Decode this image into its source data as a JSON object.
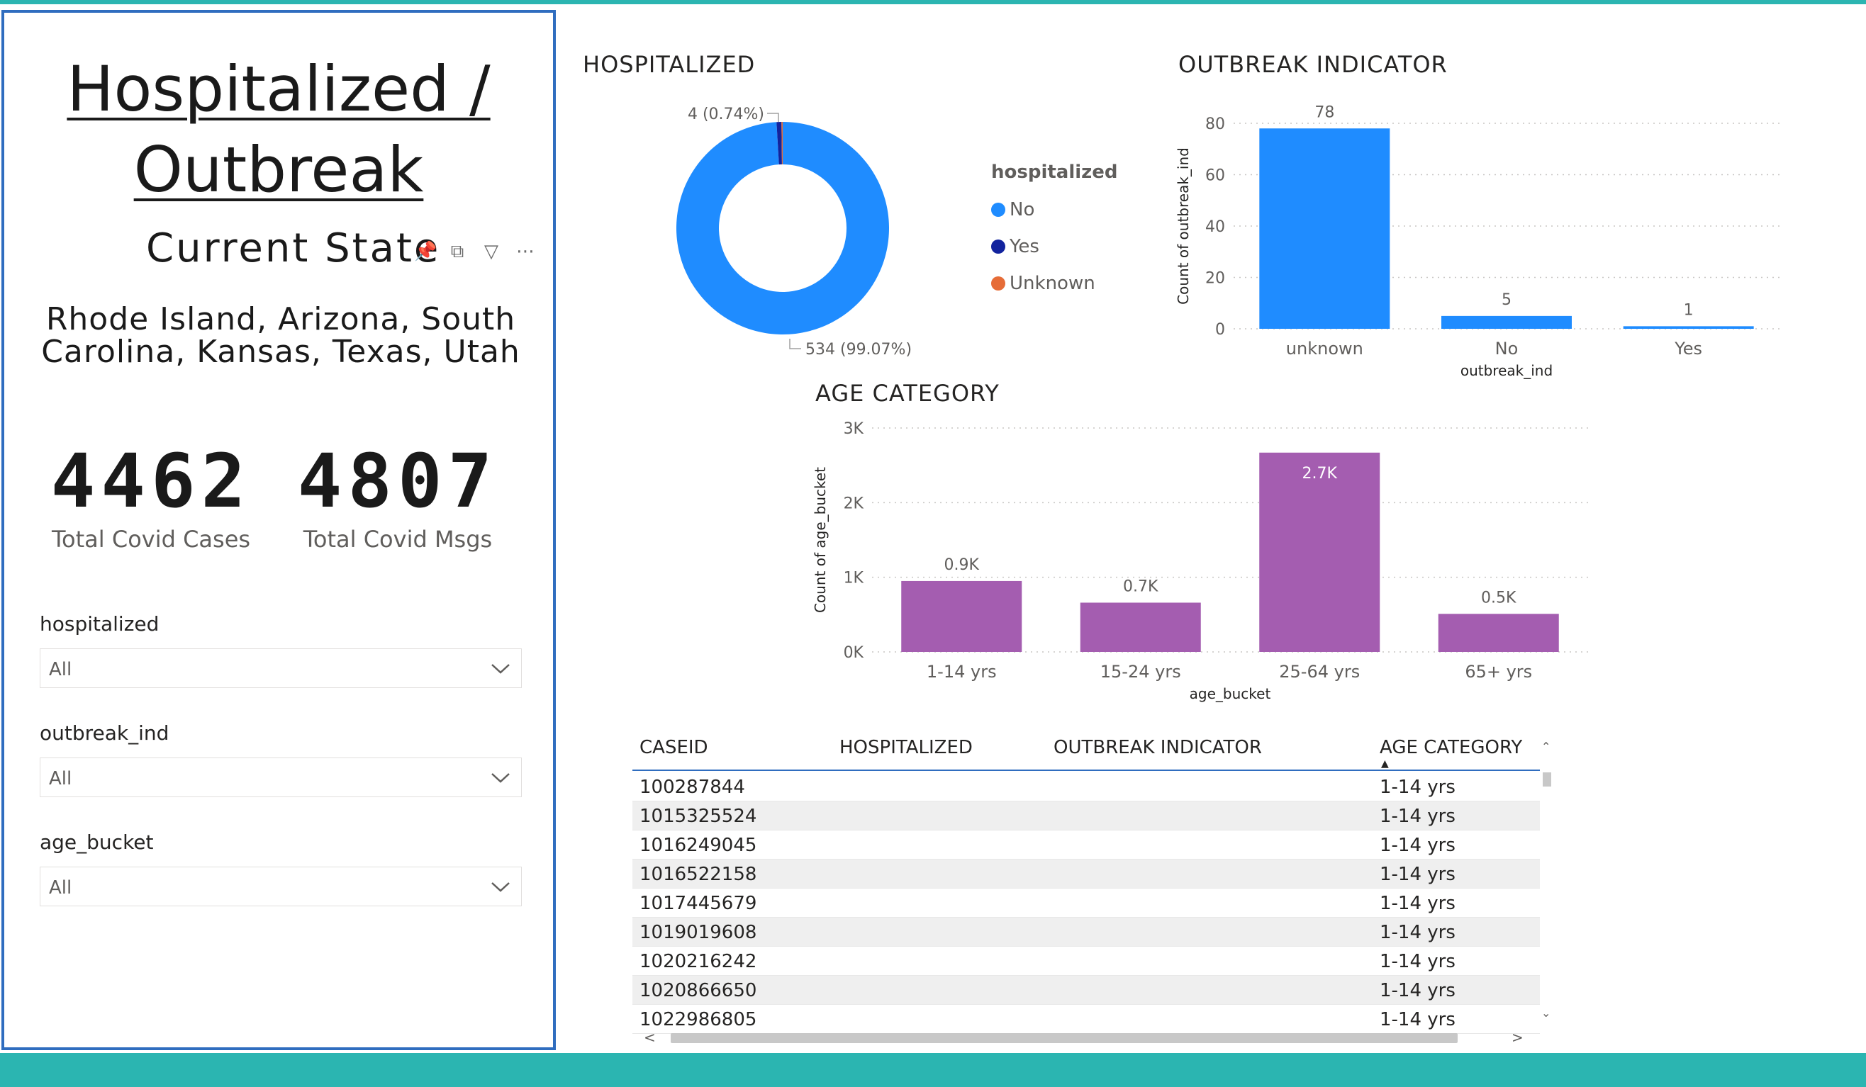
{
  "left_panel": {
    "title_line1": "Hospitalized / ",
    "title_line2": "Outbreak",
    "current_state_label": "Current State",
    "icons": [
      "pin-icon",
      "copy-icon",
      "filter-icon",
      "more-options-icon"
    ],
    "states_line1": "Rhode Island, Arizona, South",
    "states_line2": "Carolina, Kansas, Texas, Utah",
    "kpis": [
      {
        "value": "4462",
        "label": "Total Covid Cases"
      },
      {
        "value": "4807",
        "label": "Total Covid Msgs"
      }
    ],
    "slicers": [
      {
        "title": "hospitalized",
        "value": "All"
      },
      {
        "title": "outbreak_ind",
        "value": "All"
      },
      {
        "title": "age_bucket",
        "value": "All"
      }
    ]
  },
  "colors": {
    "accent_blue": "#2f6dbf",
    "no": "#1f8cff",
    "yes": "#12239e",
    "unknown": "#e66c37",
    "age_bar": "#a45db0",
    "background_band": "#2bb5b1"
  },
  "chart_data": [
    {
      "type": "pie",
      "title": "HOSPITALIZED",
      "legend_title": "hospitalized",
      "legend_position": "right",
      "slices": [
        {
          "label": "No",
          "value": 534,
          "data_label": "534 (99.07%)"
        },
        {
          "label": "Yes",
          "value": 4,
          "data_label": "4 (0.74%)"
        },
        {
          "label": "Unknown",
          "value": 1,
          "data_label": ""
        }
      ]
    },
    {
      "type": "bar",
      "title": "OUTBREAK INDICATOR",
      "categories": [
        "unknown",
        "No",
        "Yes"
      ],
      "values": [
        78,
        5,
        1
      ],
      "data_labels": [
        "78",
        "5",
        "1"
      ],
      "xlabel": "outbreak_ind",
      "ylabel": "Count of outbreak_ind",
      "ylim": [
        0,
        80
      ],
      "yticks": [
        "0",
        "20",
        "40",
        "60",
        "80"
      ],
      "ytick_values": [
        0,
        20,
        40,
        60,
        80
      ],
      "grid": true
    },
    {
      "type": "bar",
      "title": "AGE CATEGORY",
      "categories": [
        "1-14 yrs",
        "15-24 yrs",
        "25-64 yrs",
        "65+ yrs"
      ],
      "values": [
        950,
        660,
        2670,
        510
      ],
      "data_labels": [
        "0.9K",
        "0.7K",
        "2.7K",
        "0.5K"
      ],
      "xlabel": "age_bucket",
      "ylabel": "Count of age_bucket",
      "ylim": [
        0,
        3000
      ],
      "yticks": [
        "0K",
        "1K",
        "2K",
        "3K"
      ],
      "ytick_values": [
        0,
        1000,
        2000,
        3000
      ],
      "grid": true
    }
  ],
  "table": {
    "columns": [
      "CASEID",
      "HOSPITALIZED",
      "OUTBREAK INDICATOR",
      "AGE CATEGORY"
    ],
    "rows": [
      [
        "100287844",
        "",
        "",
        "1-14 yrs"
      ],
      [
        "1015325524",
        "",
        "",
        "1-14 yrs"
      ],
      [
        "1016249045",
        "",
        "",
        "1-14 yrs"
      ],
      [
        "1016522158",
        "",
        "",
        "1-14 yrs"
      ],
      [
        "1017445679",
        "",
        "",
        "1-14 yrs"
      ],
      [
        "1019019608",
        "",
        "",
        "1-14 yrs"
      ],
      [
        "1020216242",
        "",
        "",
        "1-14 yrs"
      ],
      [
        "1020866650",
        "",
        "",
        "1-14 yrs"
      ],
      [
        "1022986805",
        "",
        "",
        "1-14 yrs"
      ]
    ]
  }
}
